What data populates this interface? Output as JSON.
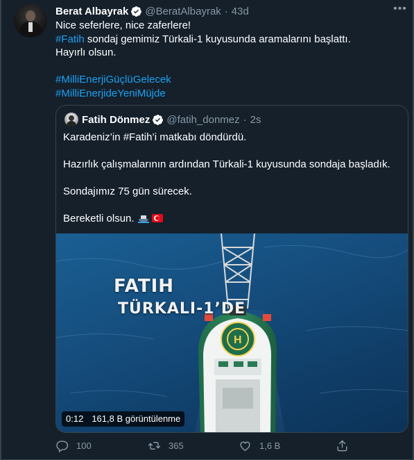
{
  "tweet": {
    "author_name": "Berat Albayrak",
    "handle": "@BeratAlbayrak",
    "separator": "·",
    "time": "43d",
    "lines": [
      [
        {
          "text": "Nice seferlere, nice zaferlere!",
          "type": "text"
        }
      ],
      [
        {
          "text": "#Fatih",
          "type": "hashtag"
        },
        {
          "text": " sondaj gemimiz Türkali-1 kuyusunda aramalarını başlattı.",
          "type": "text"
        }
      ],
      [
        {
          "text": "Hayırlı olsun.",
          "type": "text"
        }
      ],
      [],
      [
        {
          "text": "#MilliEnerjiGüçlüGelecek",
          "type": "hashtag"
        }
      ],
      [
        {
          "text": "#MilliEnerjideYeniMüjde",
          "type": "hashtag"
        }
      ]
    ]
  },
  "quote": {
    "author_name": "Fatih Dönmez",
    "handle": "@fatih_donmez",
    "separator": "·",
    "time": "2s",
    "para1": " Karadeniz’in #Fatih’i matkabı döndürdü.",
    "para2": "Hazırlık çalışmalarının ardından Türkali-1 kuyusunda sondaja başladık.",
    "para3": "Sondajımız 75 gün sürecek.",
    "para4": "Bereketli olsun.",
    "video": {
      "overlay_line1": "FATIH",
      "overlay_line2": "TÜRKALI-1’DE",
      "duration": "0:12",
      "views": "161,8 B görüntülenme"
    }
  },
  "actions": {
    "replies": "100",
    "retweets": "365",
    "likes": "1,6 B"
  },
  "colors": {
    "background": "#15202b",
    "border": "#38444d",
    "muted": "#8899a6",
    "link": "#1da1f2",
    "verified": "#1da1f2"
  },
  "icons": [
    "avatar",
    "verified-badge-icon",
    "more-icon",
    "ship-emoji-icon",
    "turkish-flag-icon",
    "reply-icon",
    "retweet-icon",
    "like-icon",
    "share-icon"
  ]
}
